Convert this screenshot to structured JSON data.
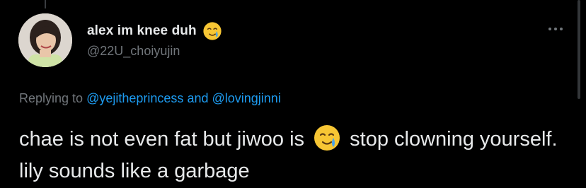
{
  "author": {
    "display_name": "alex im knee duh",
    "name_emoji": "face-holding-back-tears-icon",
    "handle": "@22U_choiyujin"
  },
  "reply": {
    "prefix": "Replying to",
    "mention_1": "@yejitheprincess",
    "conjunction": "and",
    "mention_2": "@lovingjinni"
  },
  "tweet": {
    "text_before_emoji": "chae is not even fat but jiwoo is",
    "emoji": "face-holding-back-tears-icon",
    "text_after_emoji": "stop clowning yourself. lily sounds like a garbage"
  },
  "more_icon": "more-horizontal-icon",
  "colors": {
    "background": "#000000",
    "primary_text": "#e7e9ea",
    "secondary_text": "#71767b",
    "link": "#1d9bf0",
    "emoji_yellow": "#f7c634",
    "emoji_tear": "#4aa3e8"
  }
}
